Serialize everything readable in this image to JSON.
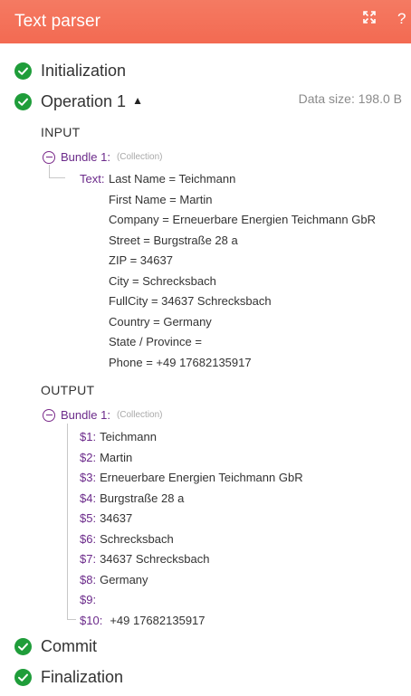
{
  "header": {
    "title": "Text parser",
    "expand_icon": "expand-icon",
    "help_label": "?"
  },
  "steps": {
    "initialization": "Initialization",
    "operation": "Operation 1",
    "commit": "Commit",
    "finalization": "Finalization"
  },
  "data_size": "Data size: 198.0 B",
  "input": {
    "section_label": "INPUT",
    "bundle_label": "Bundle 1:",
    "bundle_type": "(Collection)",
    "text_key": "Text:",
    "text_lines": [
      "Last Name = Teichmann",
      "First Name = Martin",
      "Company = Erneuerbare Energien Teichmann GbR",
      "Street = Burgstraße 28 a",
      "ZIP = 34637",
      "City = Schrecksbach",
      "FullCity = 34637 Schrecksbach",
      "Country = Germany",
      "State / Province =",
      "Phone = +49 17682135917"
    ]
  },
  "output": {
    "section_label": "OUTPUT",
    "bundle_label": "Bundle 1:",
    "bundle_type": "(Collection)",
    "items": [
      {
        "key": "$1:",
        "value": "Teichmann"
      },
      {
        "key": "$2:",
        "value": "Martin"
      },
      {
        "key": "$3:",
        "value": "Erneuerbare Energien Teichmann GbR"
      },
      {
        "key": "$4:",
        "value": "Burgstraße 28 a"
      },
      {
        "key": "$5:",
        "value": "34637"
      },
      {
        "key": "$6:",
        "value": "Schrecksbach"
      },
      {
        "key": "$7:",
        "value": "34637 Schrecksbach"
      },
      {
        "key": "$8:",
        "value": "Germany"
      },
      {
        "key": "$9:",
        "value": ""
      },
      {
        "key": "$10:",
        "value": "+49 17682135917"
      }
    ]
  },
  "colors": {
    "header": "#f36a52",
    "check": "#1f9d3a",
    "key": "#6b2a8a"
  }
}
